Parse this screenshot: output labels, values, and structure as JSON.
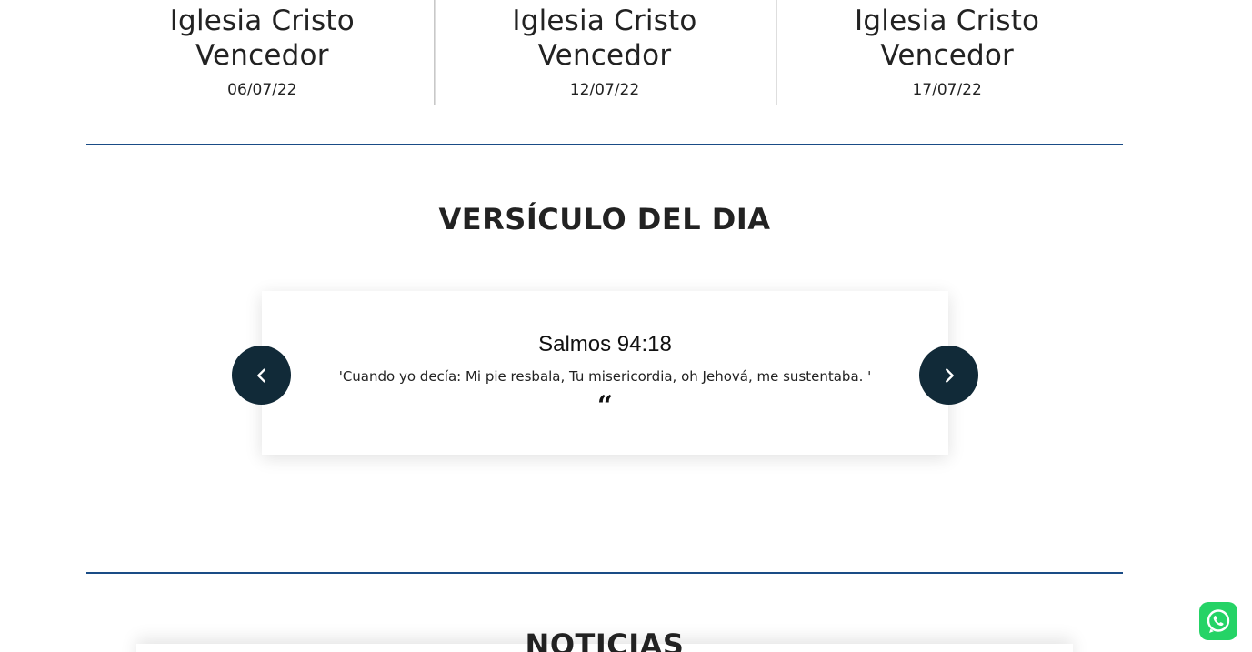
{
  "events": [
    {
      "title_line1": "Iglesia Cristo",
      "title_line2": "Vencedor",
      "date": "06/07/22"
    },
    {
      "title_line1": "Iglesia Cristo",
      "title_line2": "Vencedor",
      "date": "12/07/22"
    },
    {
      "title_line1": "Iglesia Cristo",
      "title_line2": "Vencedor",
      "date": "17/07/22"
    }
  ],
  "verse_section": {
    "title": "VERSÍCULO DEL DIA",
    "reference": "Salmos 94:18",
    "text": "'Cuando yo decía: Mi pie resbala, Tu misericordia, oh Jehová, me sustentaba. '",
    "quote_icon": "quote-left-icon",
    "prev_icon": "chevron-left-icon",
    "next_icon": "chevron-right-icon"
  },
  "news_section": {
    "title": "NOTICIAS"
  },
  "whatsapp": {
    "icon": "whatsapp-icon",
    "color": "#25d366"
  },
  "colors": {
    "divider": "#1a4c86",
    "nav_button": "#112a38"
  }
}
